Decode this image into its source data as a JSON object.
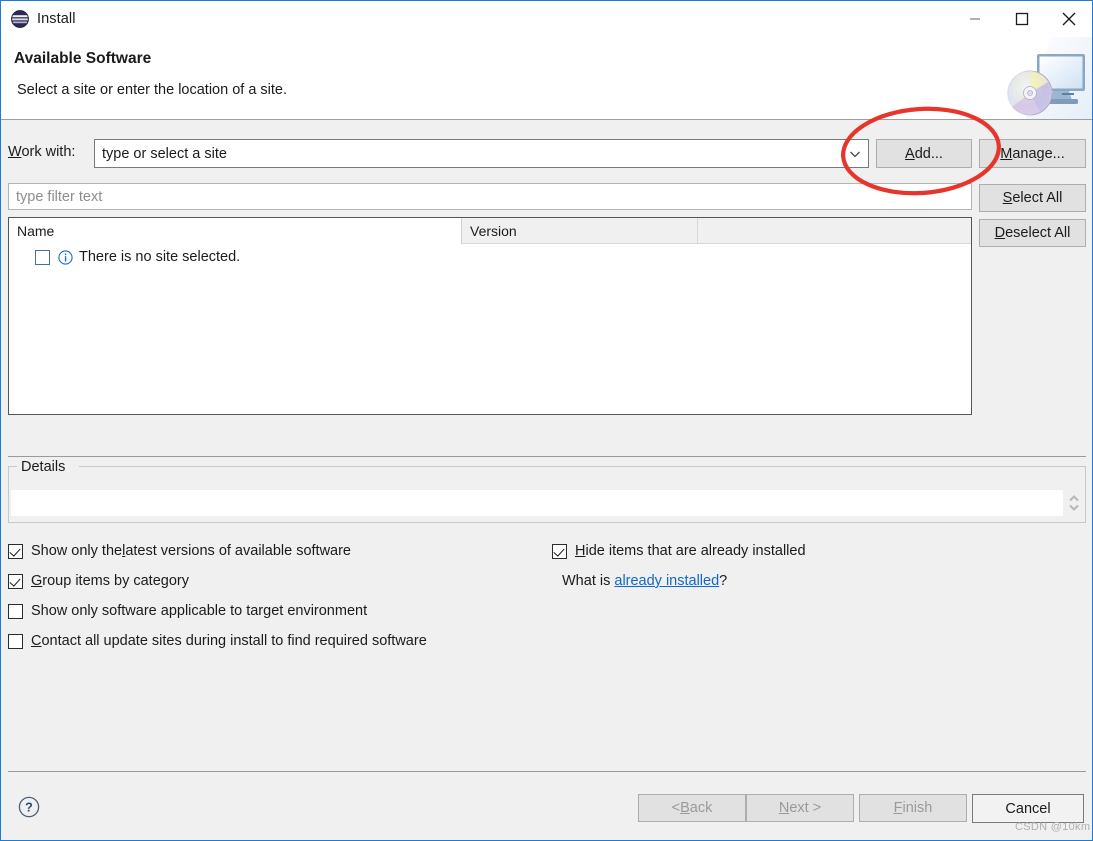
{
  "window": {
    "title": "Install",
    "app_icon": "eclipse-icon",
    "controls": {
      "minimize": "minimize-icon",
      "maximize": "maximize-icon",
      "close": "close-icon"
    }
  },
  "header": {
    "title": "Available Software",
    "subtitle": "Select a site or enter the location of a site.",
    "banner_icon": "monitor-with-disc-icon"
  },
  "work_with": {
    "label": "Work with:",
    "label_mnemonic": "W",
    "label_rest": "ork with:",
    "value": "type or select a site",
    "arrow_icon": "chevron-down-icon"
  },
  "buttons": {
    "add": {
      "prefix": "",
      "mnemonic": "A",
      "rest": "dd...",
      "full": "Add..."
    },
    "manage": {
      "prefix": "",
      "mnemonic": "M",
      "rest": "anage...",
      "full": "Manage..."
    },
    "select_all": {
      "prefix": "",
      "mnemonic": "S",
      "rest": "elect All",
      "full": "Select All"
    },
    "deselect_all": {
      "prefix": "",
      "mnemonic": "D",
      "rest": "eselect All",
      "full": "Deselect All"
    }
  },
  "filter": {
    "placeholder": "type filter text",
    "value": ""
  },
  "table": {
    "columns": [
      "Name",
      "Version",
      ""
    ],
    "rows": [
      {
        "checked": false,
        "icon": "info-icon",
        "name": "There is no site selected.",
        "version": ""
      }
    ]
  },
  "details": {
    "group_label": "Details",
    "content": "",
    "spinner_icon": "up-down-chevron-icon"
  },
  "options": {
    "latest": {
      "checked": true,
      "pre": "Show only the ",
      "mnemonic": "l",
      "post": "atest versions of available software"
    },
    "group_by_category": {
      "checked": true,
      "pre": "",
      "mnemonic": "G",
      "post": "roup items by category"
    },
    "target_environment": {
      "checked": false,
      "pre": "Show only software applicable to target environment",
      "mnemonic": "",
      "post": ""
    },
    "contact_all": {
      "checked": false,
      "pre": "",
      "mnemonic": "C",
      "post": "ontact all update sites during install to find required software"
    },
    "hide_installed": {
      "checked": true,
      "pre": "",
      "mnemonic": "H",
      "post": "ide items that are already installed"
    }
  },
  "what_is": {
    "prefix": "What is ",
    "link": "already installed",
    "suffix": "?"
  },
  "footer": {
    "help_icon": "help-question-icon",
    "back": {
      "full": "< Back",
      "pre": "< ",
      "mnemonic": "B",
      "post": "ack",
      "disabled": true
    },
    "next": {
      "full": "Next >",
      "pre": "",
      "mnemonic": "N",
      "post": "ext >",
      "disabled": true
    },
    "finish": {
      "full": "Finish",
      "pre": "",
      "mnemonic": "F",
      "post": "inish",
      "disabled": true
    },
    "cancel": {
      "full": "Cancel",
      "pre": "Cancel",
      "mnemonic": "",
      "post": "",
      "disabled": false
    }
  },
  "annotation": {
    "shape": "ellipse",
    "color": "#e8352c",
    "target": "add-button"
  },
  "watermark": "CSDN @10km",
  "colors": {
    "window_border": "#1a7cd4",
    "dialog_bg": "#f0f0f0",
    "link": "#1068c8",
    "annotation_red": "#e8352c"
  }
}
